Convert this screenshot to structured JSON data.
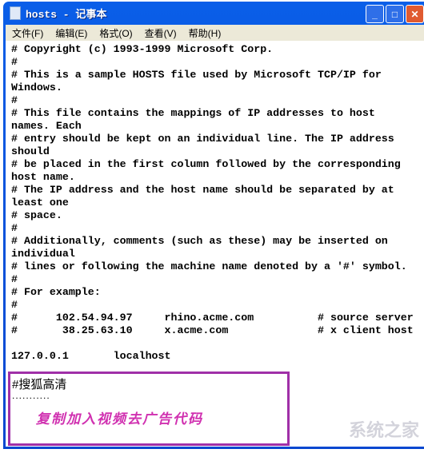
{
  "window": {
    "title": "hosts - 记事本",
    "icon": "notepad-icon",
    "buttons": [
      "minimize",
      "maximize",
      "close"
    ]
  },
  "menu": [
    "文件(F)",
    "编辑(E)",
    "格式(O)",
    "查看(V)",
    "帮助(H)"
  ],
  "content": "# Copyright (c) 1993-1999 Microsoft Corp.\n#\n# This is a sample HOSTS file used by Microsoft TCP/IP for\nWindows.\n#\n# This file contains the mappings of IP addresses to host\nnames. Each\n# entry should be kept on an individual line. The IP address\nshould\n# be placed in the first column followed by the corresponding\nhost name.\n# The IP address and the host name should be separated by at\nleast one\n# space.\n#\n# Additionally, comments (such as these) may be inserted on\nindividual\n# lines or following the machine name denoted by a '#' symbol.\n#\n# For example:\n#\n#      102.54.94.97     rhino.acme.com          # source server\n#       38.25.63.10     x.acme.com              # x client host\n\n127.0.0.1       localhost",
  "annotation": {
    "line1": "#搜狐高清",
    "dots": "...........",
    "note": "复制加入视频去广告代码",
    "color": "#d030b0",
    "border": "#a030a8"
  },
  "watermark": "系统之家"
}
